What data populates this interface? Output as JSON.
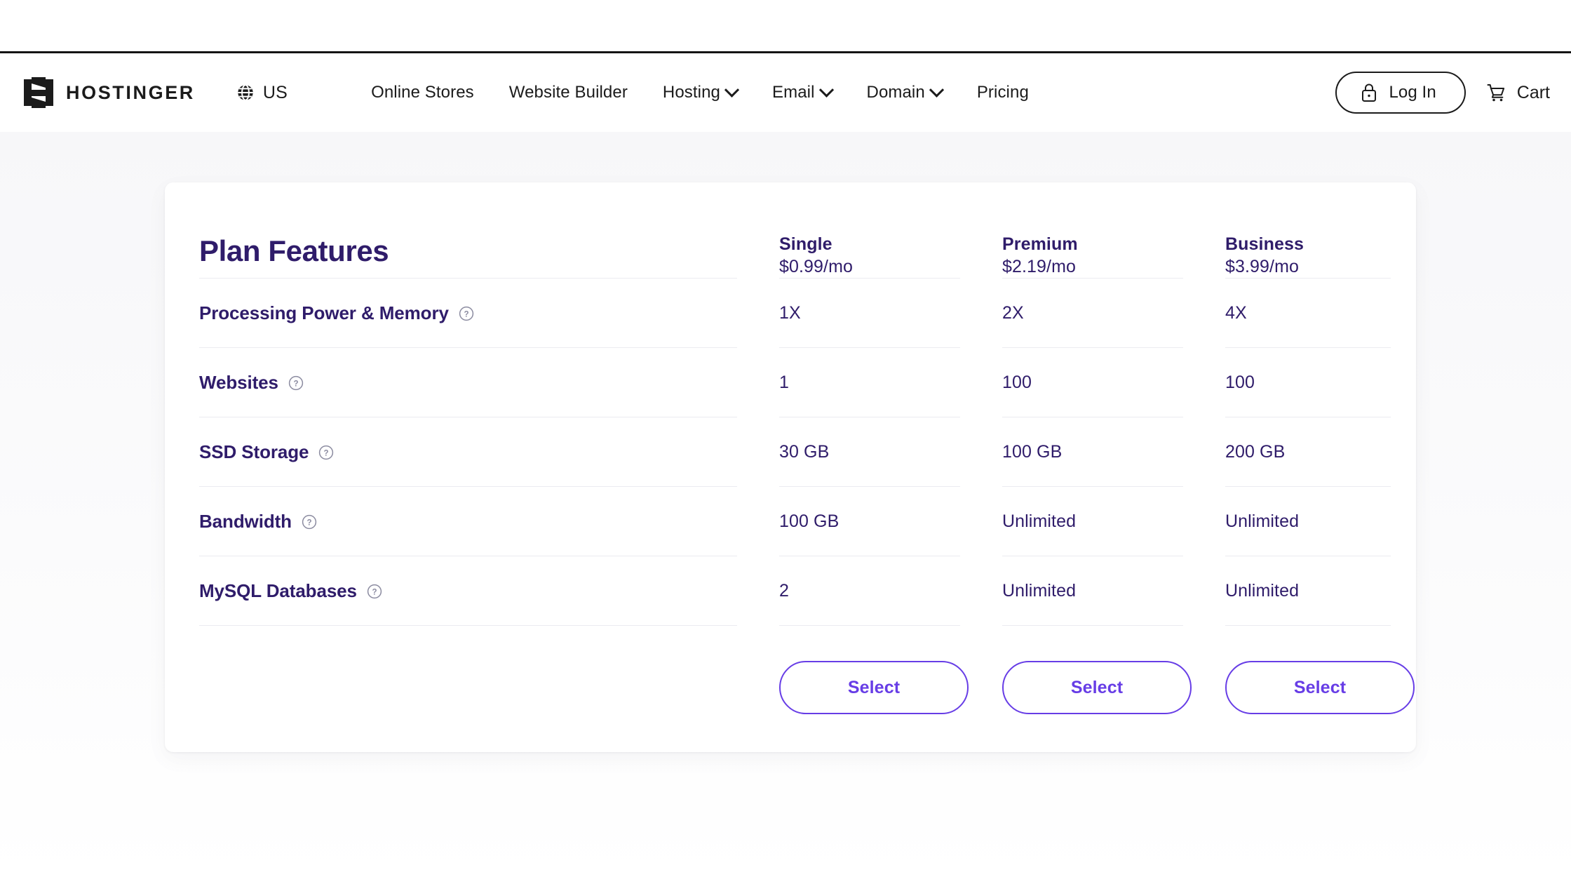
{
  "header": {
    "brand_name": "HOSTINGER",
    "brand_icon": "hostinger-logo-icon",
    "locale": {
      "label": "US",
      "icon": "globe-icon"
    },
    "nav": [
      {
        "label": "Online Stores",
        "has_dropdown": false
      },
      {
        "label": "Website Builder",
        "has_dropdown": false
      },
      {
        "label": "Hosting",
        "has_dropdown": true
      },
      {
        "label": "Email",
        "has_dropdown": true
      },
      {
        "label": "Domain",
        "has_dropdown": true
      },
      {
        "label": "Pricing",
        "has_dropdown": false
      }
    ],
    "login": {
      "label": "Log In",
      "icon": "lock-icon"
    },
    "cart": {
      "label": "Cart",
      "icon": "shopping-cart-icon"
    }
  },
  "comparison": {
    "title": "Plan Features",
    "plans": [
      {
        "name": "Single",
        "price": "$0.99/mo",
        "cta": "Select"
      },
      {
        "name": "Premium",
        "price": "$2.19/mo",
        "cta": "Select"
      },
      {
        "name": "Business",
        "price": "$3.99/mo",
        "cta": "Select"
      }
    ],
    "features": [
      {
        "label": "Processing Power & Memory",
        "help": "help-icon",
        "values": [
          "1X",
          "2X",
          "4X"
        ]
      },
      {
        "label": "Websites",
        "help": "help-icon",
        "values": [
          "1",
          "100",
          "100"
        ]
      },
      {
        "label": "SSD Storage",
        "help": "help-icon",
        "values": [
          "30 GB",
          "100 GB",
          "200 GB"
        ]
      },
      {
        "label": "Bandwidth",
        "help": "help-icon",
        "values": [
          "100 GB",
          "Unlimited",
          "Unlimited"
        ]
      },
      {
        "label": "MySQL Databases",
        "help": "help-icon",
        "values": [
          "2",
          "Unlimited",
          "Unlimited"
        ]
      }
    ]
  },
  "colors": {
    "brand_purple": "#673de6",
    "heading_indigo": "#2f1c6a",
    "text_dark": "#1b1b1b",
    "divider": "#ebebf0",
    "page_bg": "#f7f7f9"
  }
}
